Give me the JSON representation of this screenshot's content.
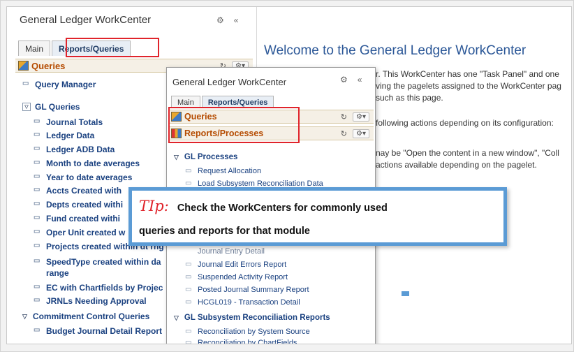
{
  "back_panel": {
    "title": "General Ledger WorkCenter",
    "tabs": [
      "Main",
      "Reports/Queries"
    ],
    "queries_label": "Queries",
    "items_top": [
      "Query Manager"
    ],
    "group1_label": "GL Queries",
    "group1_items": [
      "Journal Totals",
      "Ledger Data",
      "Ledger ADB Data",
      "Month to date averages",
      "Year to date averages",
      "Accts Created with",
      "Depts created withi",
      "Fund created withi",
      "Oper Unit created w",
      "Projects created within dt rng",
      "SpeedType created within da",
      "range",
      "EC with Chartfields by Projec",
      "JRNLs Needing Approval"
    ],
    "group2_label": "Commitment Control Queries",
    "group2_items": [
      "Budget Journal Detail Report"
    ]
  },
  "welcome": {
    "title": "Welcome to the General Ledger WorkCenter",
    "lines": [
      "r. This WorkCenter has one \"Task Panel\" and one",
      "ving the pagelets assigned to the WorkCenter pag",
      "such as this page.",
      "following actions depending on its configuration:",
      "nay be \"Open the content in a new window\", \"Coll",
      "actions available depending on the pagelet."
    ]
  },
  "front_panel": {
    "title": "General Ledger WorkCenter",
    "tabs": [
      "Main",
      "Reports/Queries"
    ],
    "section1": "Queries",
    "section2": "Reports/Processes",
    "group1_label": "GL Processes",
    "group1_items": [
      "Request Allocation",
      "Load Subsystem Reconciliation Data"
    ],
    "partial_item": "Journal Entry Detail",
    "group2_items": [
      "Journal Edit Errors Report",
      "Suspended Activity Report",
      "Posted Journal Summary Report",
      "HCGL019 - Transaction Detail"
    ],
    "group2_label": "GL Subsystem Reconciliation Reports",
    "group3_items": [
      "Reconciliation by System Source",
      "Reconciliation by ChartFields"
    ]
  },
  "tip": {
    "label": "TIp:",
    "line1": "Check the WorkCenters for commonly used",
    "line2": "queries and reports for that module"
  },
  "colors": {
    "link": "#1a4180",
    "highlight_box": "#e0242b",
    "callout_border": "#5b9bd5",
    "section_text": "#b54b00"
  },
  "icons": {
    "gear": "gear-icon",
    "collapse": "double-chevron-left-icon",
    "refresh": "refresh-icon",
    "link": "link-icon",
    "group_toggle": "collapse-toggle-icon"
  }
}
